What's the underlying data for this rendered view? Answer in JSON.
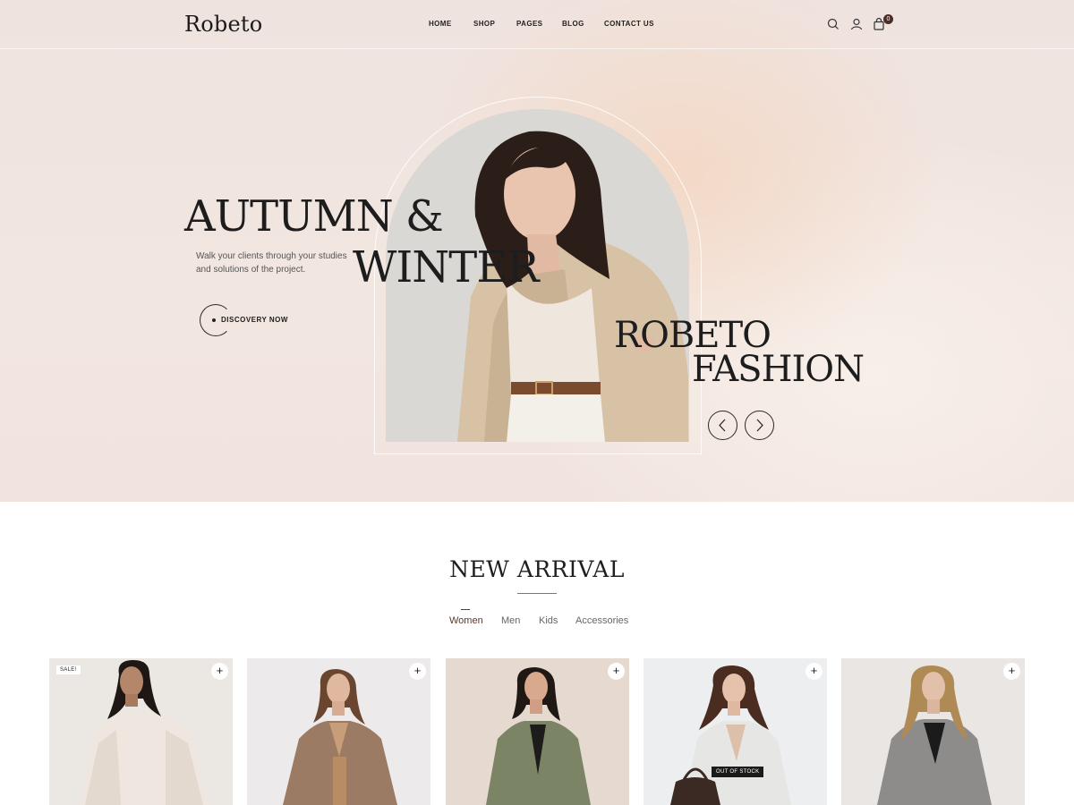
{
  "header": {
    "logo": "Robeto",
    "nav": [
      "HOME",
      "SHOP",
      "PAGES",
      "BLOG",
      "CONTACT US"
    ],
    "cart_count": "0",
    "icons": [
      "search-icon",
      "user-icon",
      "shopping-bag-icon"
    ]
  },
  "hero": {
    "headline_line1": "AUTUMN &",
    "headline_line2": "WINTER",
    "description": "Walk your clients through your studies and solutions of the project.",
    "cta_label": "DISCOVERY NOW",
    "brand_line1": "ROBETO",
    "brand_line2": "FASHION",
    "prev_icon": "chevron-left-icon",
    "next_icon": "chevron-right-icon",
    "accent_color": "#4a2f28"
  },
  "new_arrival": {
    "title": "NEW ARRIVAL",
    "filters": [
      "Women",
      "Men",
      "Kids",
      "Accessories"
    ],
    "active_filter": "Women",
    "products": [
      {
        "badge": "SALE!",
        "action": "+"
      },
      {
        "badge": "",
        "action": "+"
      },
      {
        "badge": "",
        "action": "+"
      },
      {
        "badge": "OUT OF STOCK",
        "action": "+"
      },
      {
        "badge": "",
        "action": "+"
      }
    ]
  }
}
